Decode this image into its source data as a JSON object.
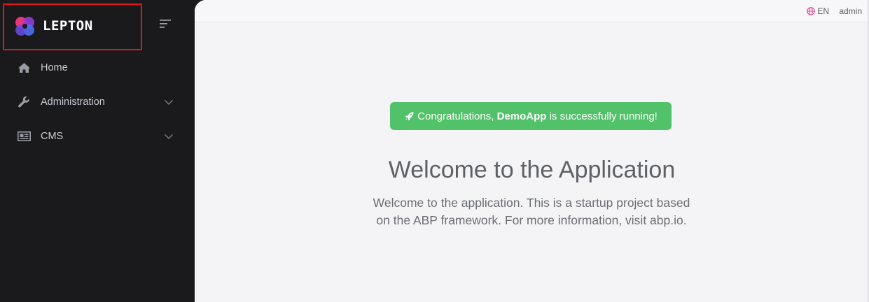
{
  "brand": {
    "name": "LEPTON"
  },
  "sidebar": {
    "items": [
      {
        "label": "Home",
        "icon": "home-icon",
        "has_children": false
      },
      {
        "label": "Administration",
        "icon": "wrench-icon",
        "has_children": true
      },
      {
        "label": "CMS",
        "icon": "newspaper-icon",
        "has_children": true
      }
    ]
  },
  "topbar": {
    "language": "EN",
    "user": "admin"
  },
  "alert": {
    "prefix": "Congratulations, ",
    "app_name": "DemoApp",
    "suffix": " is successfully running!"
  },
  "welcome": {
    "title": "Welcome to the Application",
    "text": "Welcome to the application. This is a startup project based on the ABP framework. For more information, visit abp.io."
  },
  "colors": {
    "sidebar_bg": "#1a1a1c",
    "content_bg": "#f4f4f6",
    "success": "#52c26a",
    "highlight_border": "#e1141b"
  }
}
